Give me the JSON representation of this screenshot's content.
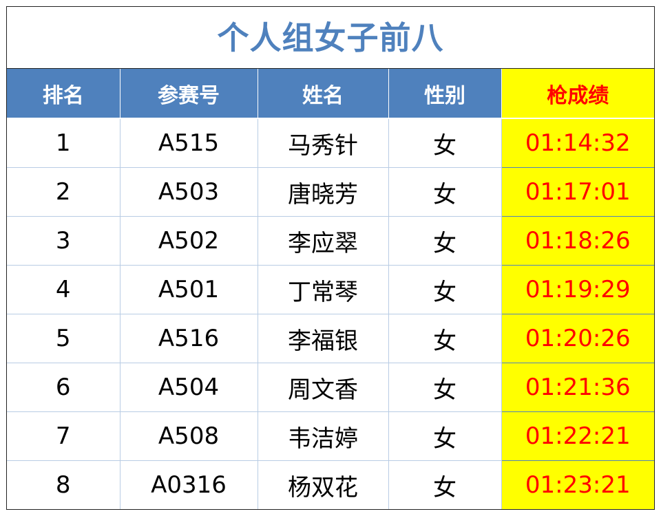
{
  "title": "个人组女子前八",
  "columns": {
    "rank": "排名",
    "bib": "参赛号",
    "name": "姓名",
    "gender": "性别",
    "gun_time": "枪成绩"
  },
  "rows": [
    {
      "rank": "1",
      "bib": "A515",
      "name": "马秀针",
      "gender": "女",
      "gun_time": "01:14:32"
    },
    {
      "rank": "2",
      "bib": "A503",
      "name": "唐晓芳",
      "gender": "女",
      "gun_time": "01:17:01"
    },
    {
      "rank": "3",
      "bib": "A502",
      "name": "李应翠",
      "gender": "女",
      "gun_time": "01:18:26"
    },
    {
      "rank": "4",
      "bib": "A501",
      "name": "丁常琴",
      "gender": "女",
      "gun_time": "01:19:29"
    },
    {
      "rank": "5",
      "bib": "A516",
      "name": "李福银",
      "gender": "女",
      "gun_time": "01:20:26"
    },
    {
      "rank": "6",
      "bib": "A504",
      "name": "周文香",
      "gender": "女",
      "gun_time": "01:21:36"
    },
    {
      "rank": "7",
      "bib": "A508",
      "name": "韦洁婷",
      "gender": "女",
      "gun_time": "01:22:21"
    },
    {
      "rank": "8",
      "bib": "A0316",
      "name": "杨双花",
      "gender": "女",
      "gun_time": "01:23:21"
    }
  ],
  "colors": {
    "header_blue": "#4f81bd",
    "highlight_yellow": "#ffff00",
    "time_red": "#ff0000"
  }
}
